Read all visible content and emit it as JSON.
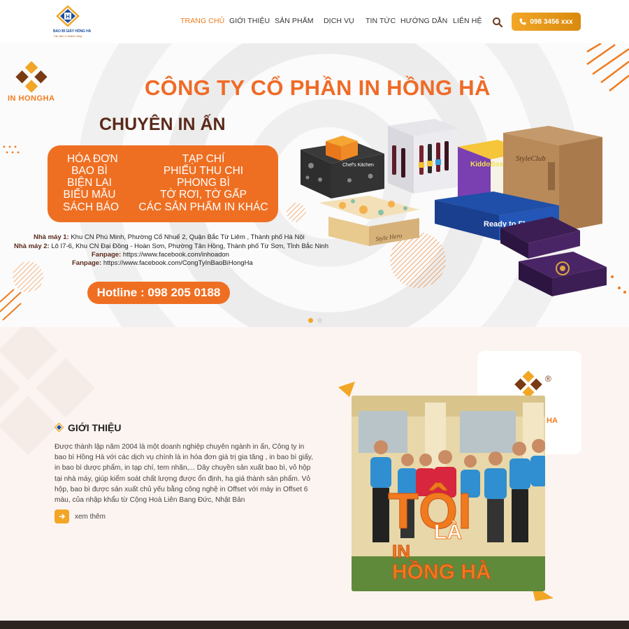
{
  "header": {
    "logo_line1": "BAO BÌ GIẤY HỒNG HÀ",
    "logo_line2": "Tận tâm vì khách hàng",
    "nav": [
      {
        "label": "TRANG CHỦ",
        "active": true
      },
      {
        "label": "GIỚI THIỆU",
        "active": false
      },
      {
        "label": "SẢN PHẨM",
        "active": false
      },
      {
        "label": "DỊCH VỤ",
        "active": false
      },
      {
        "label": "TIN TỨC",
        "active": false
      },
      {
        "label": "HƯỚNG DẪN",
        "active": false
      },
      {
        "label": "LIÊN HỆ",
        "active": false
      }
    ],
    "search_icon": "search-icon",
    "hotline": "098 3456 xxx",
    "hotline_icon": "phone-icon"
  },
  "hero": {
    "brand": "IN HONGHA",
    "title": "CÔNG TY CỔ PHẦN IN HỒNG HÀ",
    "subtitle": "CHUYÊN IN ẤN",
    "services_left": [
      "HÓA ĐƠN",
      "BAO BÌ",
      "BIỆN LAI",
      "BIỂU MẪU",
      "SÁCH BÁO"
    ],
    "services_right": [
      "TẠP CHÍ",
      "PHIẾU THU CHI",
      "PHONG BÌ",
      "TỜ RƠI, TỜ GẤP",
      "CÁC SẢN PHẨM IN KHÁC"
    ],
    "factory1_label": "Nhà máy 1:",
    "factory1": "Khu CN Phú Minh, Phường Cổ Nhuế 2, Quận Bắc Từ Liêm , Thành phố Hà Nội",
    "factory2_label": "Nhà máy 2:",
    "factory2": "Lô I7-6, Khu CN Đại Đồng - Hoàn Sơn, Phường Tân Hồng, Thành phố Từ Sơn, Tỉnh Bắc Ninh",
    "fanpage1_label": "Fanpage:",
    "fanpage1": "https://www.facebook.com/inhoadon",
    "fanpage2_label": "Fanpage:",
    "fanpage2": "https://www.facebook.com/CongTyInBaoBiHongHa",
    "hotline": "Hotline : 098 205 0188",
    "product_labels": [
      "Chef's Kitchen",
      "KiddoBox",
      "StyleClub",
      "Ready to Fl",
      "Style Hero"
    ],
    "slides_total": 2,
    "slide_active": 1,
    "accent": "#ef6f22"
  },
  "about": {
    "title": "GIỚI THIỆU",
    "text": "Được thành lập năm 2004 là một doanh nghiệp chuyên ngành in ấn, Công ty in bao bì Hồng Hà với các dịch vụ chính là in hóa đơn giá trị gia tăng , in bao bì giấy, in bao bì dược phẩm, in tạp chí, tem nhãn,... Dây chuyền sản xuất bao bì, vỏ hộp tại nhà máy, giúp kiểm soát chất lượng được ổn định, hạ giá thành sản phẩm. Vỏ hộp, bao bì được sản xuất chủ yếu bằng công nghệ in Offset với máy in Offset 6 màu, của nhập khẩu từ Cộng Hoà Liên Bang Đức, Nhật Bản",
    "more": "xem thêm",
    "photo_sign_line1": "TÔI",
    "photo_sign_line2": "LÀ",
    "photo_sign_line3": "IN",
    "photo_sign_line4": "HỒNG HÀ",
    "badge_text": "HA"
  }
}
